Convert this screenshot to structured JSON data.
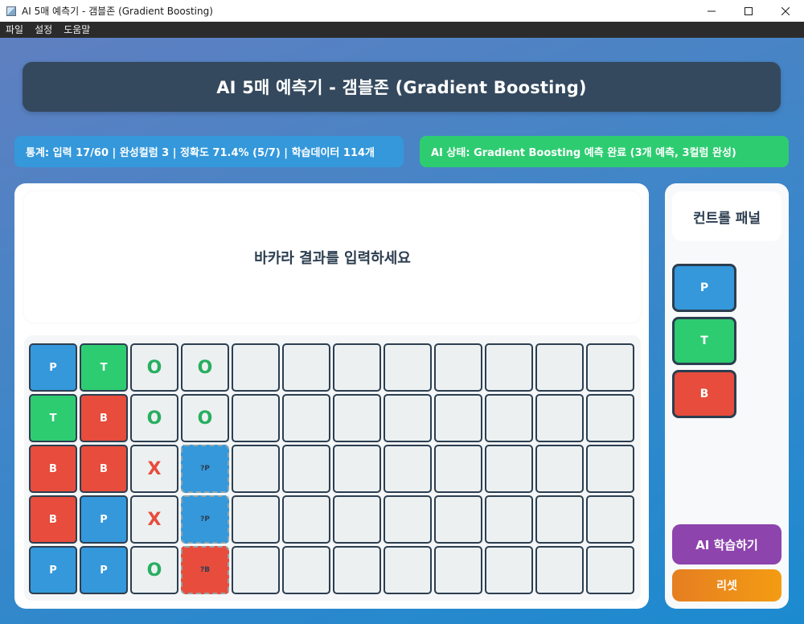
{
  "window": {
    "title": "AI 5매 예측기 - 갬블존 (Gradient Boosting)"
  },
  "menu": {
    "items": [
      "파일",
      "설정",
      "도움말"
    ]
  },
  "header": {
    "title": "AI 5매 예측기 - 갬블존 (Gradient Boosting)"
  },
  "status": {
    "stats": "통계: 입력 17/60 | 완성컬럼 3 | 정확도 71.4% (5/7) | 학습데이터 114개",
    "ai": "AI 상태: Gradient Boosting 예측 완료 (3개 예측, 3컬럼 완성)"
  },
  "message": "바카라 결과를 입력하세요",
  "grid": {
    "rows": [
      [
        {
          "kind": "p",
          "text": "P"
        },
        {
          "kind": "t",
          "text": "T"
        },
        {
          "kind": "mo",
          "text": "O"
        },
        {
          "kind": "mo",
          "text": "O"
        },
        {
          "kind": "empty",
          "text": ""
        },
        {
          "kind": "empty",
          "text": ""
        },
        {
          "kind": "empty",
          "text": ""
        },
        {
          "kind": "empty",
          "text": ""
        },
        {
          "kind": "empty",
          "text": ""
        },
        {
          "kind": "empty",
          "text": ""
        },
        {
          "kind": "empty",
          "text": ""
        },
        {
          "kind": "empty",
          "text": ""
        }
      ],
      [
        {
          "kind": "t",
          "text": "T"
        },
        {
          "kind": "b",
          "text": "B"
        },
        {
          "kind": "mo",
          "text": "O"
        },
        {
          "kind": "mo",
          "text": "O"
        },
        {
          "kind": "empty",
          "text": ""
        },
        {
          "kind": "empty",
          "text": ""
        },
        {
          "kind": "empty",
          "text": ""
        },
        {
          "kind": "empty",
          "text": ""
        },
        {
          "kind": "empty",
          "text": ""
        },
        {
          "kind": "empty",
          "text": ""
        },
        {
          "kind": "empty",
          "text": ""
        },
        {
          "kind": "empty",
          "text": ""
        }
      ],
      [
        {
          "kind": "b",
          "text": "B"
        },
        {
          "kind": "b",
          "text": "B"
        },
        {
          "kind": "mx",
          "text": "X"
        },
        {
          "kind": "pred-p",
          "text": "?P"
        },
        {
          "kind": "empty",
          "text": ""
        },
        {
          "kind": "empty",
          "text": ""
        },
        {
          "kind": "empty",
          "text": ""
        },
        {
          "kind": "empty",
          "text": ""
        },
        {
          "kind": "empty",
          "text": ""
        },
        {
          "kind": "empty",
          "text": ""
        },
        {
          "kind": "empty",
          "text": ""
        },
        {
          "kind": "empty",
          "text": ""
        }
      ],
      [
        {
          "kind": "b",
          "text": "B"
        },
        {
          "kind": "p",
          "text": "P"
        },
        {
          "kind": "mx",
          "text": "X"
        },
        {
          "kind": "pred-p",
          "text": "?P"
        },
        {
          "kind": "empty",
          "text": ""
        },
        {
          "kind": "empty",
          "text": ""
        },
        {
          "kind": "empty",
          "text": ""
        },
        {
          "kind": "empty",
          "text": ""
        },
        {
          "kind": "empty",
          "text": ""
        },
        {
          "kind": "empty",
          "text": ""
        },
        {
          "kind": "empty",
          "text": ""
        },
        {
          "kind": "empty",
          "text": ""
        }
      ],
      [
        {
          "kind": "p",
          "text": "P"
        },
        {
          "kind": "p",
          "text": "P"
        },
        {
          "kind": "mo",
          "text": "O"
        },
        {
          "kind": "pred-b",
          "text": "?B"
        },
        {
          "kind": "empty",
          "text": ""
        },
        {
          "kind": "empty",
          "text": ""
        },
        {
          "kind": "empty",
          "text": ""
        },
        {
          "kind": "empty",
          "text": ""
        },
        {
          "kind": "empty",
          "text": ""
        },
        {
          "kind": "empty",
          "text": ""
        },
        {
          "kind": "empty",
          "text": ""
        },
        {
          "kind": "empty",
          "text": ""
        }
      ]
    ]
  },
  "control_panel": {
    "title": "컨트롤 패널",
    "buttons": {
      "player": "P",
      "tie": "T",
      "banker": "B"
    },
    "train": "AI 학습하기",
    "reset": "리셋"
  },
  "colors": {
    "player": "#3498db",
    "tie": "#2ecc71",
    "banker": "#e74c3c",
    "header": "#34495e",
    "train": "#8e44ad",
    "reset": "#f39c12"
  }
}
